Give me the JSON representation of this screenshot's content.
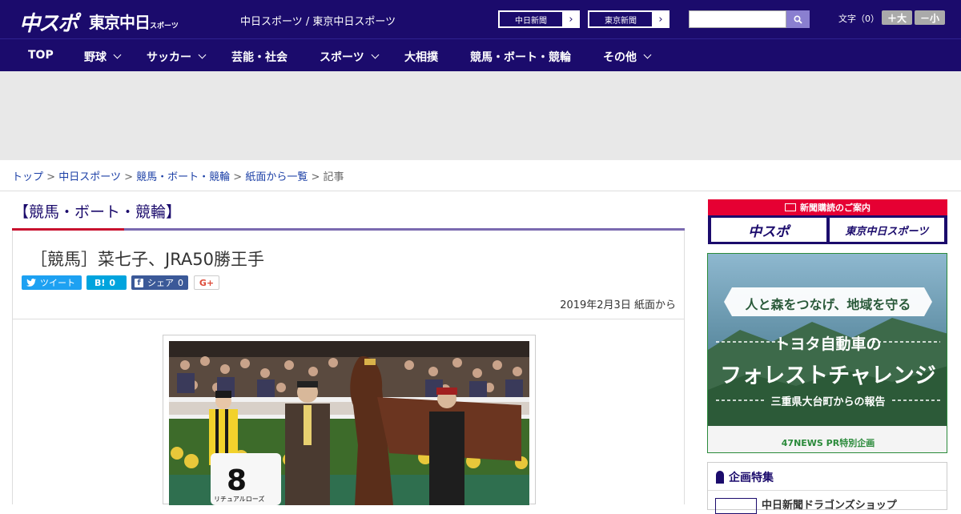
{
  "header": {
    "logo_main": "中スポ",
    "logo_tokyo": "東京中日",
    "logo_tokyo_small": "スポーツ",
    "site_subtitle": "中日スポーツ / 東京中日スポーツ",
    "paper_links": [
      "中日新聞",
      "東京新聞"
    ],
    "search_placeholder": "",
    "font_size_label": "文字（0）",
    "font_larger": "＋大",
    "font_smaller": "－小"
  },
  "nav": {
    "items": [
      {
        "label": "TOP",
        "dropdown": false
      },
      {
        "label": "野球",
        "dropdown": true
      },
      {
        "label": "サッカー",
        "dropdown": true
      },
      {
        "label": "芸能・社会",
        "dropdown": false
      },
      {
        "label": "スポーツ",
        "dropdown": true
      },
      {
        "label": "大相撲",
        "dropdown": false
      },
      {
        "label": "競馬・ボート・競輪",
        "dropdown": false
      },
      {
        "label": "その他",
        "dropdown": true
      }
    ]
  },
  "breadcrumb": {
    "items": [
      "トップ",
      "中日スポーツ",
      "競馬・ボート・競輪",
      "紙面から一覧"
    ],
    "current": "記事",
    "separator": ">"
  },
  "article": {
    "category": "【競馬・ボート・競輪】",
    "headline": "［競馬］菜七子、JRA50勝王手",
    "share": {
      "tweet_label": "ツイート",
      "hatena_label": "B!",
      "hatena_count": "0",
      "facebook_label": "シェア",
      "facebook_count": "0",
      "gplus_label": "G+"
    },
    "date": "2019年2月3日",
    "source": "紙面から",
    "photo_number_cloth": "8",
    "photo_cloth_text": "リチュアルローズ"
  },
  "sidebar": {
    "subscribe_header": "新聞購読のご案内",
    "subscribe_links": [
      "中スポ",
      "東京中日スポーツ"
    ],
    "ad_banner": {
      "line1": "人と森をつなげ、地域を守る",
      "line2": "トヨタ自動車の",
      "line3": "フォレストチャレンジ",
      "line4": "三重県大台町からの報告",
      "line5": "47NEWS PR特別企画"
    },
    "special_header": "企画特集",
    "special_item": "中日新聞ドラゴンズショップ"
  },
  "colors": {
    "brand_navy": "#1b0b6c",
    "accent_red": "#c8102e",
    "link_blue": "#1b3fa6"
  }
}
